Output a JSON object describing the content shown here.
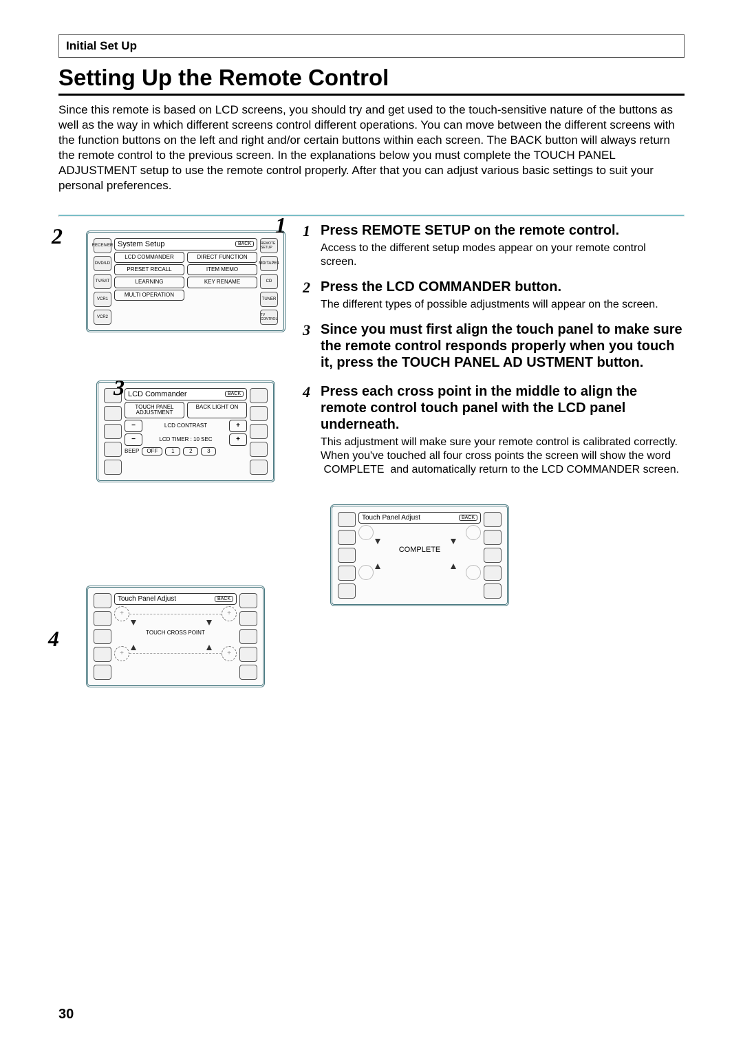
{
  "header": {
    "section": "Initial Set Up"
  },
  "title": "Setting Up the Remote Control",
  "intro": "Since this remote is based on LCD screens, you should try and get used to the touch-sensitive nature of the buttons as well as the way in which different screens control different operations. You can move between the different screens with the function buttons on the left and right and/or certain buttons within each screen. The BACK button will always return the remote control to the previous screen. In the explanations below you must complete the TOUCH PANEL ADJUSTMENT setup to use the remote control properly. After that you can adjust various basic settings to suit your personal preferences.",
  "panel1": {
    "title": "System Setup",
    "back": "BACK",
    "left_side": [
      "RECEIVER",
      "DVD/LD",
      "TV/SAT",
      "VCR1",
      "VCR2"
    ],
    "right_side": [
      "REMOTE SETUP",
      "MD/TAPE1",
      "CD",
      "TUNER",
      "TV CONTROL"
    ],
    "cells": {
      "lcd_commander": "LCD COMMANDER",
      "direct_function": "DIRECT FUNCTION",
      "preset_recall": "PRESET RECALL",
      "item_memo": "ITEM MEMO",
      "learning": "LEARNING",
      "key_rename": "KEY RENAME",
      "multi_operation": "MULTI OPERATION"
    }
  },
  "callouts": {
    "one": "1",
    "two": "2",
    "three": "3",
    "four": "4"
  },
  "panel2": {
    "title": "LCD Commander",
    "back": "BACK",
    "touch_panel_adjustment": "TOUCH PANEL ADJUSTMENT",
    "back_light_on": "BACK LIGHT ON",
    "lcd_contrast": "LCD CONTRAST",
    "lcd_timer": "LCD TIMER : 10 SEC",
    "beep": "BEEP",
    "off": "OFF",
    "beep_1": "1",
    "beep_2": "2",
    "beep_3": "3",
    "minus": "−",
    "plus": "+"
  },
  "panel3": {
    "title": "Touch Panel Adjust",
    "back": "BACK",
    "label": "TOUCH CROSS POINT",
    "plus": "+"
  },
  "panel4": {
    "title": "Touch Panel Adjust",
    "back": "BACK",
    "complete": "COMPLETE"
  },
  "page_number": "30",
  "steps": [
    {
      "num": "1",
      "head": "Press REMOTE SETUP on the remote control.",
      "desc": "Access to the different setup modes appear on your remote control screen."
    },
    {
      "num": "2",
      "head": "Press the LCD COMMANDER button.",
      "desc": "The different types of possible adjustments will appear on the screen."
    },
    {
      "num": "3",
      "head": "Since you must first align the touch panel to make sure the remote control responds properly when you touch it, press the TOUCH PANEL AD USTMENT button.",
      "desc": ""
    },
    {
      "num": "4",
      "head": "Press each cross point in the middle to align the remote control touch panel with the LCD panel underneath.",
      "desc": "This adjustment will make sure your remote control is calibrated correctly.\nWhen you've touched all four cross points the screen will show the word  COMPLETE  and automatically return to the LCD COMMANDER screen."
    }
  ]
}
